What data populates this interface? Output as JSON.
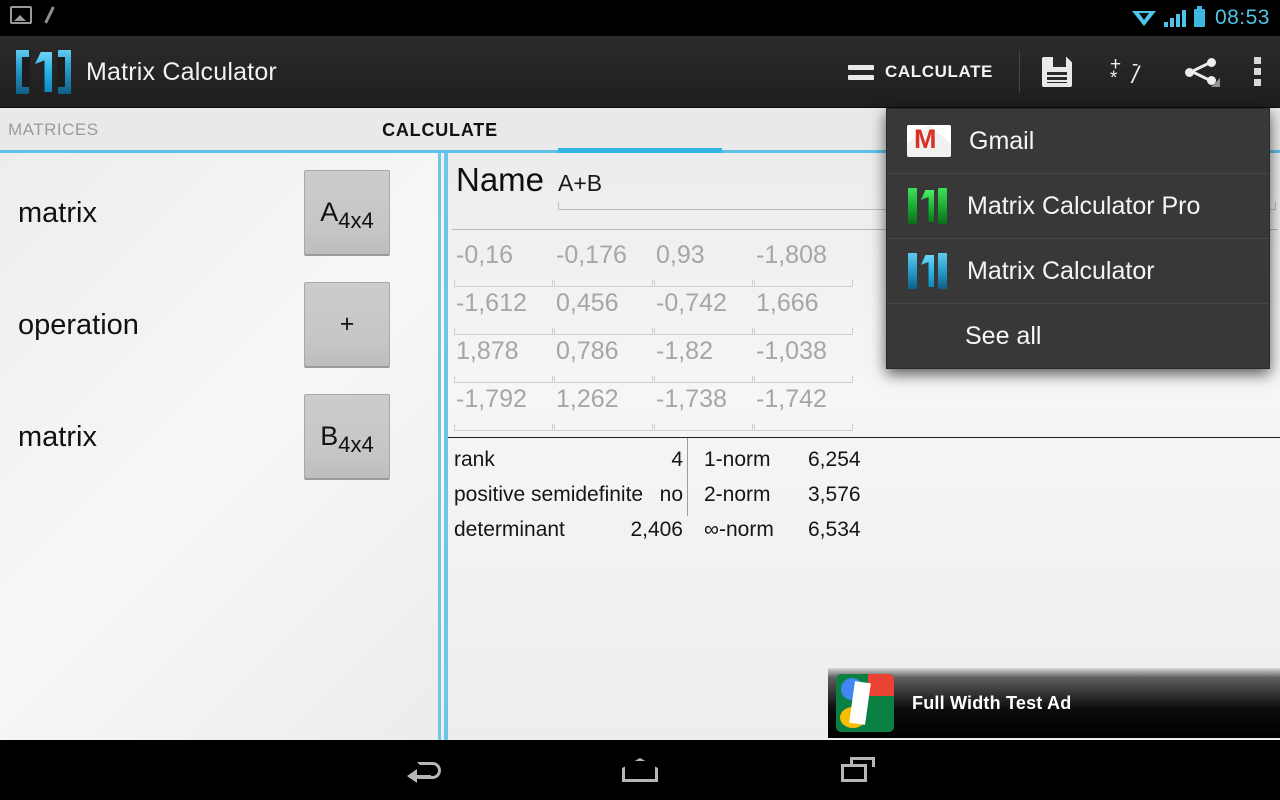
{
  "status_bar": {
    "time": "08:53",
    "icons": [
      "screenshot-icon",
      "slash-icon",
      "wifi-icon",
      "cellular-signal-icon",
      "battery-icon"
    ]
  },
  "action_bar": {
    "app_title": "Matrix Calculator",
    "app_icon": "matrix-calculator-logo",
    "calculate_label": "CALCULATE",
    "icons": {
      "equals": "equals-icon",
      "save": "save-floppy-icon",
      "operations": "operations-icon",
      "share": "share-icon",
      "overflow": "overflow-menu-icon"
    },
    "operations_glyphs": {
      "plus": "+",
      "minus": "-",
      "times": "*",
      "divide": "/"
    }
  },
  "tabs": {
    "left_tab": "MATRICES",
    "active_tab": "CALCULATE",
    "accent_color": "#33b5e5"
  },
  "left_pane": {
    "rows": [
      {
        "label": "matrix",
        "button_main": "A",
        "button_sub": "4x4"
      },
      {
        "label": "operation",
        "button_main": "+",
        "button_sub": ""
      },
      {
        "label": "matrix",
        "button_main": "B",
        "button_sub": "4x4"
      }
    ]
  },
  "result_pane": {
    "name_label": "Name",
    "name_value": "A+B",
    "matrix": [
      [
        "-0,16",
        "-0,176",
        "0,93",
        "-1,808"
      ],
      [
        "-1,612",
        "0,456",
        "-0,742",
        "1,666"
      ],
      [
        "1,878",
        "0,786",
        "-1,82",
        "-1,038"
      ],
      [
        "-1,792",
        "1,262",
        "-1,738",
        "-1,742"
      ]
    ],
    "stats_left": [
      {
        "key": "rank",
        "value": "4"
      },
      {
        "key": "positive semidefinite",
        "value": "no"
      },
      {
        "key": "determinant",
        "value": "2,406"
      }
    ],
    "stats_right": [
      {
        "key": "1-norm",
        "value": "6,254"
      },
      {
        "key": "2-norm",
        "value": "3,576"
      },
      {
        "key": "∞-norm",
        "value": "6,534"
      }
    ]
  },
  "share_dropdown": {
    "items": [
      {
        "label": "Gmail",
        "icon": "gmail-icon"
      },
      {
        "label": "Matrix Calculator Pro",
        "icon": "matrix-calculator-pro-icon"
      },
      {
        "label": "Matrix Calculator",
        "icon": "matrix-calculator-icon"
      }
    ],
    "see_all_label": "See all"
  },
  "ad_banner": {
    "text": "Full Width Test Ad",
    "logo": "google-logo"
  },
  "nav_bar": {
    "back": "back-icon",
    "home": "home-icon",
    "recents": "recents-icon"
  }
}
